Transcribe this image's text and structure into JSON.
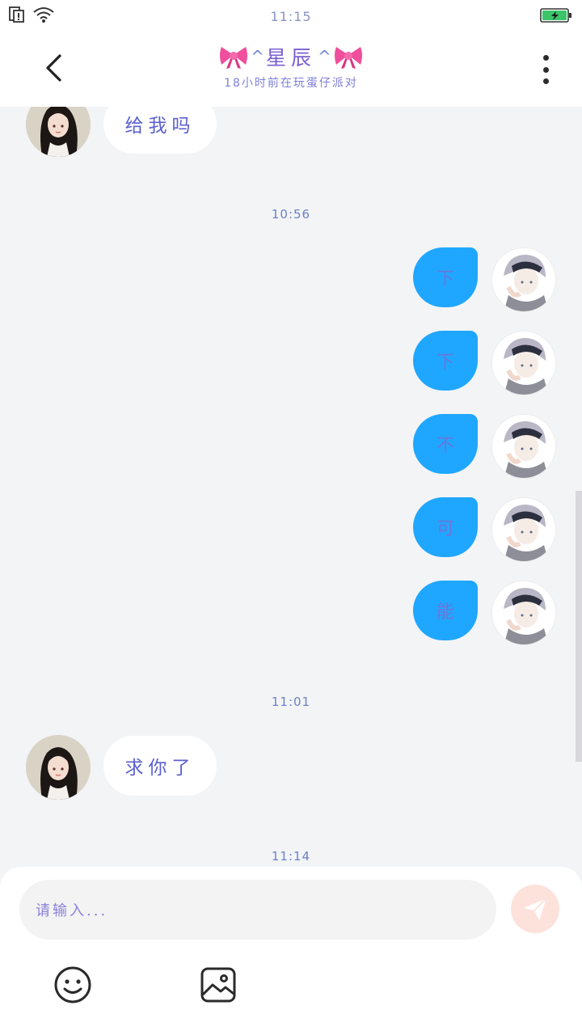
{
  "status_bar": {
    "time": "11:15"
  },
  "header": {
    "title_prefix": "^",
    "title_name": "星辰",
    "title_suffix": "^",
    "subtitle": "18小时前在玩蛋仔派对"
  },
  "messages": {
    "m1_text": "给我吗",
    "ts1": "10:56",
    "out_1": "下",
    "out_2": "下",
    "out_3": "不",
    "out_4": "可",
    "out_5": "能",
    "ts2": "11:01",
    "m2_text": "求你了",
    "ts3": "11:14"
  },
  "composer": {
    "placeholder": "请输入..."
  },
  "icons": {
    "back": "chevron-left-icon",
    "more": "more-vertical-icon",
    "send": "send-icon",
    "emoji": "smile-icon",
    "image": "image-icon"
  },
  "colors": {
    "outgoing_bubble": "#1fa7ff",
    "accent_text": "#7b63c8",
    "send_button": "#fde2dc"
  }
}
